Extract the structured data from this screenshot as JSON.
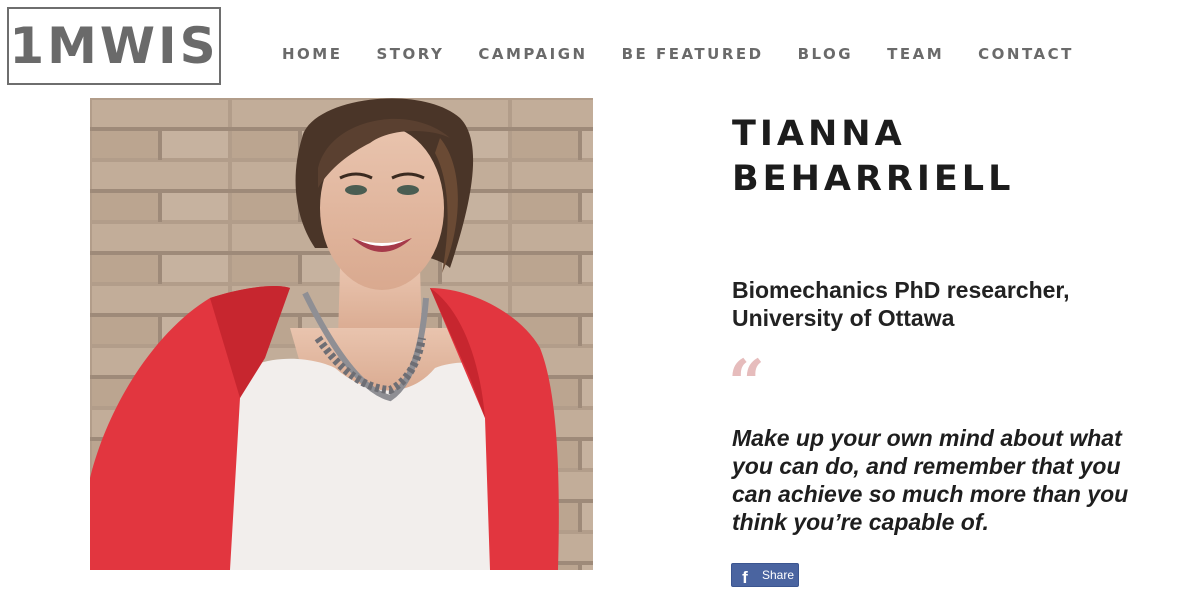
{
  "logo": {
    "text": "1MWIS"
  },
  "nav": {
    "items": [
      {
        "label": "HOME"
      },
      {
        "label": "STORY"
      },
      {
        "label": "CAMPAIGN"
      },
      {
        "label": "BE FEATURED"
      },
      {
        "label": "BLOG"
      },
      {
        "label": "TEAM"
      },
      {
        "label": "CONTACT"
      }
    ]
  },
  "profile": {
    "name_line1": "TIANNA",
    "name_line2": "BEHARRIELL",
    "role_line1": "Biomechanics PhD researcher,",
    "role_line2": "University of Ottawa",
    "quote_mark": "“",
    "quote": "Make up your own mind about what you can do, and remember that you can achieve so much more than you think you’re capable of."
  },
  "share": {
    "label": "Share",
    "icon_letter": "f",
    "icon": "facebook-icon"
  },
  "colors": {
    "nav_text": "#6a6a6a",
    "heading": "#1c1c1c",
    "quote_mark": "#e6bcbc",
    "facebook_blue": "#4a64a0"
  }
}
